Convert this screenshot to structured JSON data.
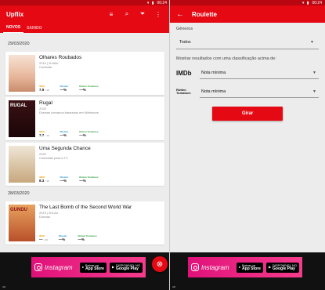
{
  "left": {
    "status_time": "00:24",
    "app_title": "Upflix",
    "tabs": [
      "NOVOS",
      "SAINDO"
    ],
    "dates": [
      "29/03/2020",
      "28/03/2020"
    ],
    "movies": [
      {
        "title": "Olhares Roubados",
        "year": "2019 | 2h40m",
        "genre": "Comédia",
        "imdb": "7.9",
        "imdb_max": "/ 10",
        "flixster": "—%",
        "rotten": "—%",
        "poster_text": "",
        "poster_color": "#f3d7c9"
      },
      {
        "title": "Rugal",
        "year": "2020",
        "genre": "Dramas coreanos baseados em Webtoons",
        "imdb": "7.7",
        "imdb_max": "/ 10",
        "flixster": "—%",
        "rotten": "—%",
        "poster_text": "RUGAL",
        "poster_color": "#2a0d0f"
      },
      {
        "title": "Uma Segunda Chance",
        "year": "2020",
        "genre": "Comédias para a TV",
        "imdb": "8.3",
        "imdb_max": "/ 10",
        "flixster": "—%",
        "rotten": "—%",
        "poster_text": "",
        "poster_color": "#d9c9a8"
      },
      {
        "title": "The Last Bomb of the Second World War",
        "year": "2019 | 2h12m",
        "genre": "Dramas",
        "imdb": "—",
        "imdb_max": "/ 10",
        "flixster": "—%",
        "rotten": "—%",
        "poster_text": "GUNDU",
        "poster_color": "#c9602c"
      }
    ],
    "rating_sources": {
      "imdb": "IMDb",
      "flixster": "Flixster",
      "rotten": "Rotten Tomatoes"
    },
    "fab_icon": "close-icon"
  },
  "right": {
    "status_time": "00:24",
    "title": "Roulette",
    "generos_label": "Gêneros",
    "generos_value": "Todos",
    "classificacao_label": "Mostrar resultados com uma classificação acima de:",
    "imdb_logo": "IMDb",
    "rotten_logo": "Rotten Tomatoes",
    "nota_imdb": "Nota mínima",
    "nota_rotten": "Nota mínima",
    "girar": "Girar"
  },
  "ad": {
    "brand": "Instagram",
    "appstore_small": "Baixar na",
    "appstore": "App Store",
    "googleplay_small": "DISPONÍVEL NO",
    "googleplay": "Google Play",
    "badge": "AD"
  },
  "colors": {
    "accent": "#e50914",
    "status": "#b80710"
  }
}
